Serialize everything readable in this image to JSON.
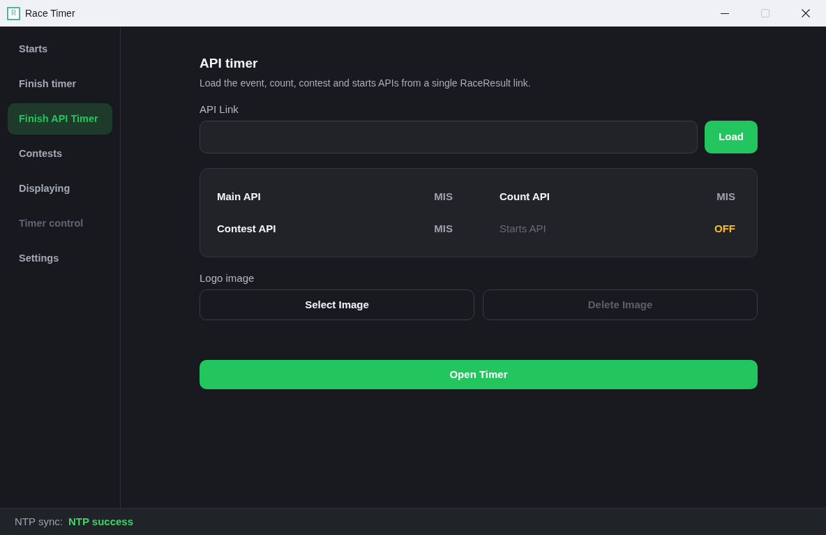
{
  "window": {
    "title": "Race Timer",
    "icon_letter": "R",
    "controls": [
      {
        "kind": "minimize",
        "disabled": false
      },
      {
        "kind": "maximize",
        "disabled": true
      },
      {
        "kind": "close",
        "disabled": false
      }
    ]
  },
  "sidebar": {
    "items": [
      {
        "label": "Starts",
        "selected": false,
        "disabled": false
      },
      {
        "label": "Finish timer",
        "selected": false,
        "disabled": false
      },
      {
        "label": "Finish API Timer",
        "selected": true,
        "disabled": false
      },
      {
        "label": "Contests",
        "selected": false,
        "disabled": false
      },
      {
        "label": "Displaying",
        "selected": false,
        "disabled": false
      },
      {
        "label": "Timer control",
        "selected": false,
        "disabled": true
      },
      {
        "label": "Settings",
        "selected": false,
        "disabled": false
      }
    ]
  },
  "page": {
    "title": "API timer",
    "description": "Load the event, count, contest and starts APIs from a single RaceResult link.",
    "api_link": {
      "label": "API Link",
      "button": "Load"
    },
    "apis": [
      {
        "name": "Main API",
        "status": "MIS",
        "disabled": false,
        "color": "#9ca3af"
      },
      {
        "name": "Count API",
        "status": "MIS",
        "disabled": false,
        "color": "#9ca3af"
      },
      {
        "name": "Contest API",
        "status": "MIS",
        "disabled": false,
        "color": "#9ca3af"
      },
      {
        "name": "Starts API",
        "status": "OFF",
        "disabled": true,
        "color": "#fbbf24"
      }
    ],
    "logo_image": {
      "label": "Logo image",
      "buttons": [
        {
          "label": "Select Image",
          "disabled": false
        },
        {
          "label": "Delete Image",
          "disabled": true
        }
      ]
    },
    "open_button": "Open Timer"
  },
  "status_bar": {
    "label": "NTP sync:",
    "value": "NTP success"
  }
}
